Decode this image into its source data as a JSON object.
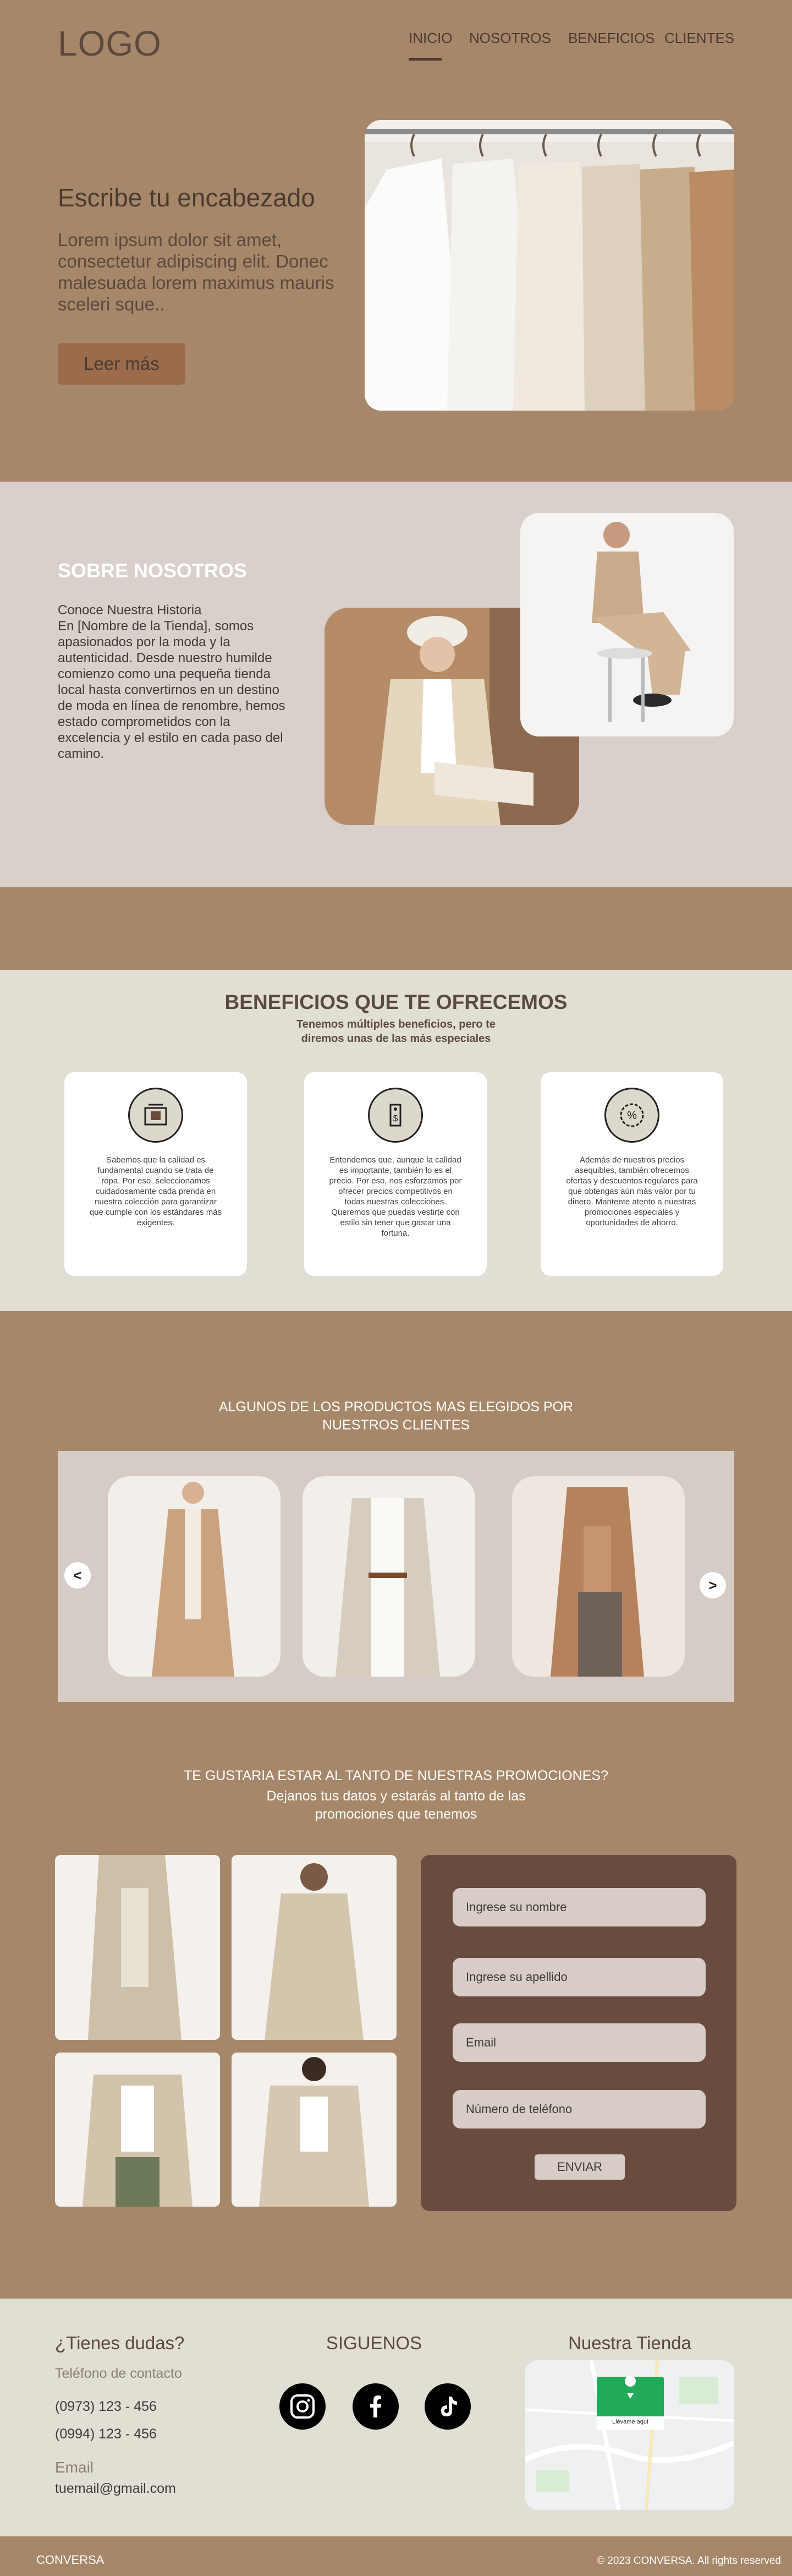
{
  "header": {
    "logo": "LOGO",
    "nav": [
      "INICIO",
      "NOSOTROS",
      "BENEFICIOS",
      "CLIENTES"
    ]
  },
  "hero": {
    "title": "Escribe tu encabezado",
    "text": "Lorem ipsum dolor sit amet, consectetur adipiscing elit. Donec malesuada lorem maximus mauris sceleri sque..",
    "button": "Leer más"
  },
  "about": {
    "title": "SOBRE NOSOTROS",
    "text": "Conoce Nuestra Historia\nEn [Nombre de la Tienda], somos apasionados por la moda y la autenticidad. Desde nuestro humilde comienzo como una pequeña tienda local hasta convertirnos en un destino de moda en línea de renombre, hemos estado comprometidos con la excelencia y el estilo en cada paso del camino."
  },
  "benefits": {
    "title": "BENEFICIOS QUE TE OFRECEMOS",
    "subtitle": "Tenemos múltiples beneficios, pero te diremos unas de las más especiales",
    "cards": [
      {
        "icon": "quality-machine-icon",
        "text": "Sabemos que la calidad es fundamental cuando se trata de ropa. Por eso, seleccionamos cuidadosamente cada prenda en nuestra colección para garantizar que cumple con los estándares más exigentes."
      },
      {
        "icon": "price-tag-icon",
        "text": "Entendemos que, aunque la calidad es importante, también lo es el precio. Por eso, nos esforzamos por ofrecer precios competitivos en todas nuestras colecciones. Queremos que puedas vestirte con estilo sin tener que gastar una fortuna."
      },
      {
        "icon": "discount-badge-icon",
        "text": "Además de nuestros precios asequibles, también ofrecemos ofertas y descuentos regulares para que obtengas aún más valor por tu dinero. Mantente atento a nuestras promociones especiales y oportunidades de ahorro."
      }
    ]
  },
  "products": {
    "title": "ALGUNOS DE LOS PRODUCTOS MAS ELEGIDOS POR NUESTROS CLIENTES",
    "prev": "<",
    "next": ">"
  },
  "promos": {
    "title": "TE GUSTARIA ESTAR AL TANTO DE NUESTRAS PROMOCIONES?",
    "subtitle": "Dejanos tus datos y estarás al tanto de las promociones que tenemos",
    "fields": [
      "Ingrese su nombre",
      "Ingrese su apellido",
      "Email",
      "Número de teléfono"
    ],
    "send": "ENVIAR"
  },
  "footer": {
    "questions": "¿Tienes dudas?",
    "contact_label": "Teléfono de contacto",
    "phone1": "(0973) 123 - 456",
    "phone2": "(0994) 123 - 456",
    "email_label": "Email",
    "email": "tuemail@gmail.com",
    "follow": "SIGUENOS",
    "store": "Nuestra Tienda",
    "map_label": "Llévame aquí",
    "brand": "CONVERSA",
    "copyright": "© 2023 CONVERSA. All rights reserved"
  },
  "colors": {
    "background": "#a68769",
    "about_bg": "#d9d0cb",
    "benefits_bg": "#e1ded4",
    "form_bg": "#6a4b3f",
    "text_dark": "#5b4a3e"
  }
}
